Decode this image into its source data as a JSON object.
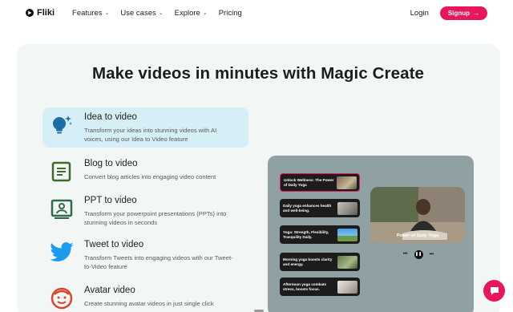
{
  "nav": {
    "logo": "Fliki",
    "items": [
      {
        "label": "Features",
        "dropdown": true
      },
      {
        "label": "Use cases",
        "dropdown": true
      },
      {
        "label": "Explore",
        "dropdown": true
      },
      {
        "label": "Pricing",
        "dropdown": false
      }
    ],
    "login": "Login",
    "signup": "Signup",
    "signup_arrow": "→"
  },
  "headline": "Make videos in minutes with Magic Create",
  "features": [
    {
      "title": "Idea to video",
      "desc": "Transform your ideas into stunning videos with AI voices, using our Idea to Video feature",
      "icon": "lightbulb-icon",
      "active": true
    },
    {
      "title": "Blog to video",
      "desc": "Convert blog articles into engaging video content",
      "icon": "document-icon",
      "active": false
    },
    {
      "title": "PPT to video",
      "desc": "Transform your powerpoint presentations (PPTs) into stunning videos in seconds",
      "icon": "presentation-icon",
      "active": false
    },
    {
      "title": "Tweet to video",
      "desc": "Transform Tweets into engaging videos with our Tweet-to-Video feature",
      "icon": "twitter-icon",
      "active": false
    },
    {
      "title": "Avatar video",
      "desc": "Create stunning avatar videos in just single click",
      "icon": "avatar-icon",
      "active": false
    }
  ],
  "demo": {
    "cards": [
      {
        "text": "Unlock Wellness: The Power of Daily Yoga",
        "active": true
      },
      {
        "text": "Daily yoga enhances health and well-being.",
        "active": false
      },
      {
        "text": "Yoga: Strength, Flexibility, Tranquility Daily.",
        "active": false
      },
      {
        "text": "Morning yoga boosts clarity and energy.",
        "active": false
      },
      {
        "text": "Afternoon yoga combats stress, boosts focus.",
        "active": false
      }
    ],
    "player_caption": "Power of Daily Yoga",
    "controls": {
      "prev": "⏮",
      "pause": "❚❚",
      "next": "⏭"
    }
  },
  "colors": {
    "accent": "#e8175d",
    "panel": "#f2f6f5",
    "active_feature": "#d6eef5",
    "demo_bg": "#8fa1a3",
    "icon_blue": "#1b6ea6"
  }
}
